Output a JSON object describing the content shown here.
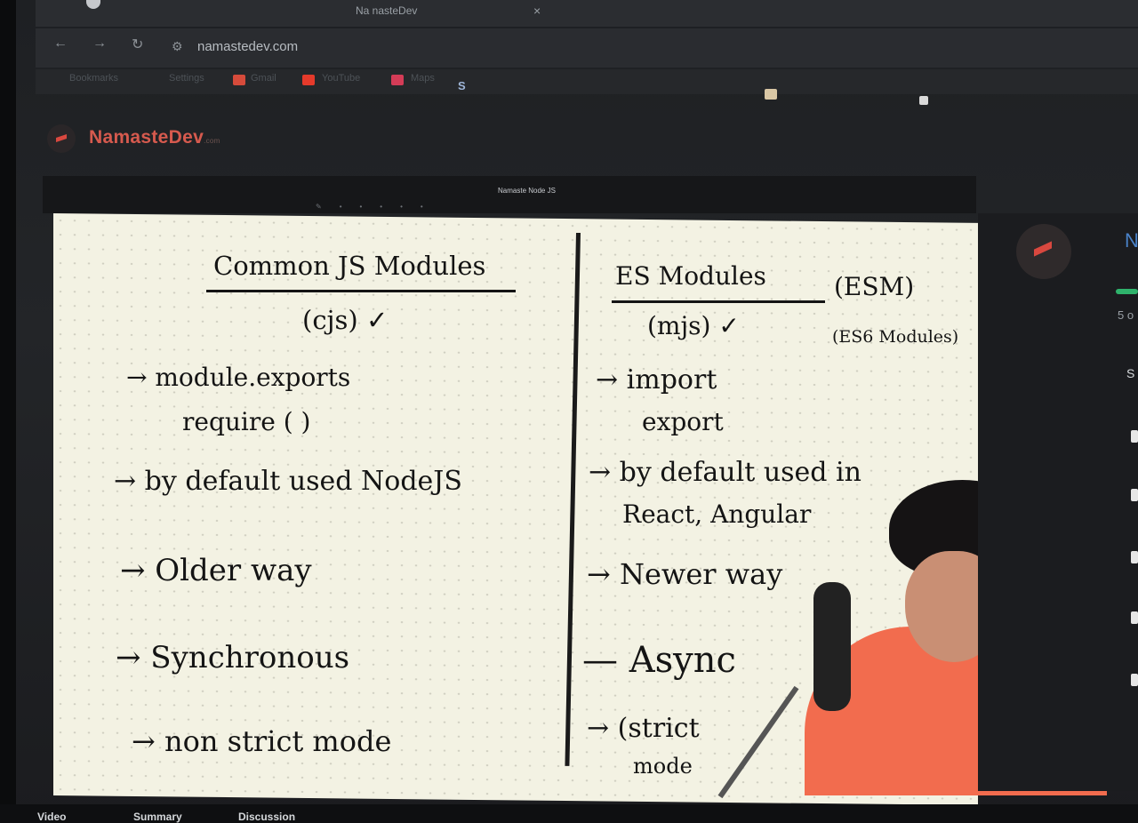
{
  "browser": {
    "tabs": [
      {
        "title": "Na nasteDev",
        "close": "×"
      }
    ],
    "url": "namastedev.com",
    "nav": {
      "back": "←",
      "forward": "→",
      "reload": "↻"
    },
    "bookmarks": [
      {
        "label": "Bookmarks"
      },
      {
        "label": "Settings"
      },
      {
        "label": "Gmail"
      },
      {
        "label": "YouTube"
      },
      {
        "label": "Maps"
      },
      {
        "label": "S"
      }
    ]
  },
  "app": {
    "brand": "NamasteDev",
    "brand_suffix": ".com",
    "video_title": "Namaste Node JS"
  },
  "board": {
    "left_heading": "Common JS Modules",
    "left_abbr": "(cjs) ✓",
    "left_items": [
      "→ module.exports",
      "require ( )",
      "→ by default used NodeJS",
      "→ Older way",
      "→ Synchronous",
      "→ non strict mode"
    ],
    "right_heading": "ES Modules",
    "right_esm": "(ESM)",
    "right_abbr": "(mjs) ✓",
    "right_es6": "(ES6 Modules)",
    "right_items": [
      "→ import",
      "export",
      "→ by default used in",
      "React, Angular",
      "→ Newer way",
      "— Async",
      "→ (strict",
      "mode"
    ]
  },
  "side": {
    "edge_letter": "N",
    "edge_count": "5 o",
    "edge_section": "S"
  },
  "bottom_tabs": [
    "Video",
    "Summary",
    "Discussion"
  ]
}
